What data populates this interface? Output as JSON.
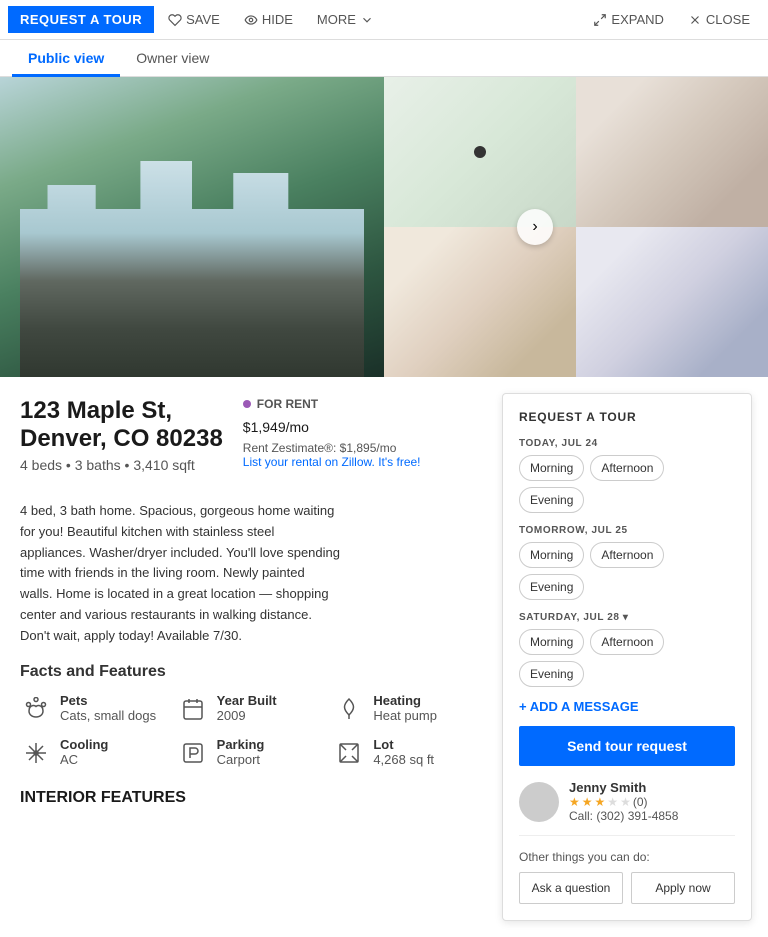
{
  "topbar": {
    "request_tour": "REQUEST A TOUR",
    "save": "SAVE",
    "hide": "HIDE",
    "more": "MORE",
    "expand": "EXPAND",
    "close": "CLOSE"
  },
  "views": {
    "tabs": [
      "Public view",
      "Owner view"
    ],
    "active": 0
  },
  "property": {
    "address_line1": "123 Maple St,",
    "address_line2": "Denver, CO 80238",
    "stats": "4 beds • 3 baths • 3,410 sqft",
    "for_rent_label": "FOR RENT",
    "price": "$1,949",
    "price_suffix": "/mo",
    "zestimate": "Rent Zestimate®: $1,895/mo",
    "zestimate_link": "List your rental on Zillow. It's free!",
    "description": "4 bed, 3 bath home. Spacious, gorgeous home waiting for you! Beautiful kitchen with stainless steel appliances. Washer/dryer included. You'll love spending time with friends in the living room. Newly painted walls. Home is located in a great location — shopping center and various restaurants in walking distance. Don't wait, apply today! Available 7/30."
  },
  "facts": {
    "title": "Facts and Features",
    "items": [
      {
        "label": "Pets",
        "value": "Cats, small dogs",
        "icon": "pets"
      },
      {
        "label": "Year Built",
        "value": "2009",
        "icon": "calendar"
      },
      {
        "label": "Heating",
        "value": "Heat pump",
        "icon": "heating"
      },
      {
        "label": "Cooling",
        "value": "AC",
        "icon": "cooling"
      },
      {
        "label": "Parking",
        "value": "Carport",
        "icon": "parking"
      },
      {
        "label": "Lot",
        "value": "4,268 sq ft",
        "icon": "lot"
      }
    ]
  },
  "interior": {
    "title": "INTERIOR FEATURES"
  },
  "tour": {
    "title": "REQUEST A TOUR",
    "days": [
      {
        "label": "TODAY, JUL 24",
        "slots": [
          "Morning",
          "Afternoon",
          "Evening"
        ]
      },
      {
        "label": "TOMORROW, JUL 25",
        "slots": [
          "Morning",
          "Afternoon",
          "Evening"
        ]
      },
      {
        "label": "SATURDAY, JUL 28 ▾",
        "slots": [
          "Morning",
          "Afternoon",
          "Evening"
        ]
      }
    ],
    "add_message": "+ ADD A MESSAGE",
    "send_button": "Send tour request",
    "agent_name": "Jenny Smith",
    "agent_rating": "(0)",
    "agent_phone": "Call: (302) 391-4858",
    "other_label": "Other things you can do:",
    "ask_button": "Ask a question",
    "apply_button": "Apply now"
  }
}
